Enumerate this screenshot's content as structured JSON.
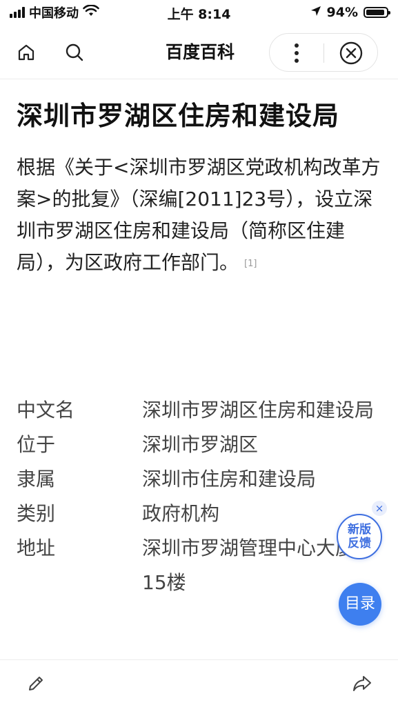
{
  "status_bar": {
    "carrier": "中国移动",
    "time": "上午 8:14",
    "battery": "94%",
    "battery_level": 0.94,
    "icons": [
      "signal-icon",
      "wifi-icon",
      "location-arrow-icon",
      "battery-icon"
    ]
  },
  "nav": {
    "title": "百度百科",
    "icons": [
      "home-icon",
      "search-icon",
      "more-icon",
      "close-icon"
    ]
  },
  "article": {
    "title": "深圳市罗湖区住房和建设局",
    "summary": "根据《关于<深圳市罗湖区党政机构改革方案>的批复》（深编[2011]23号），设立深圳市罗湖区住房和建设局（简称区住建局），为区政府工作部门。",
    "ref": "[1]"
  },
  "infobox": [
    {
      "key": "中文名",
      "value": "深圳市罗湖区住房和建设局"
    },
    {
      "key": "位于",
      "value": "深圳市罗湖区"
    },
    {
      "key": "隶属",
      "value": "深圳市住房和建设局"
    },
    {
      "key": "类别",
      "value": "政府机构"
    },
    {
      "key": "地址",
      "value": "深圳市罗湖管理中心大厦15楼"
    }
  ],
  "floating": {
    "feedback_label": "新版反馈",
    "feedback_close": "×",
    "toc_label": "目录"
  },
  "bottom_bar": {
    "icons": [
      "edit-icon",
      "share-icon"
    ]
  },
  "colors": {
    "accent": "#3e7fef",
    "text": "#111111",
    "divider": "#ececec"
  }
}
